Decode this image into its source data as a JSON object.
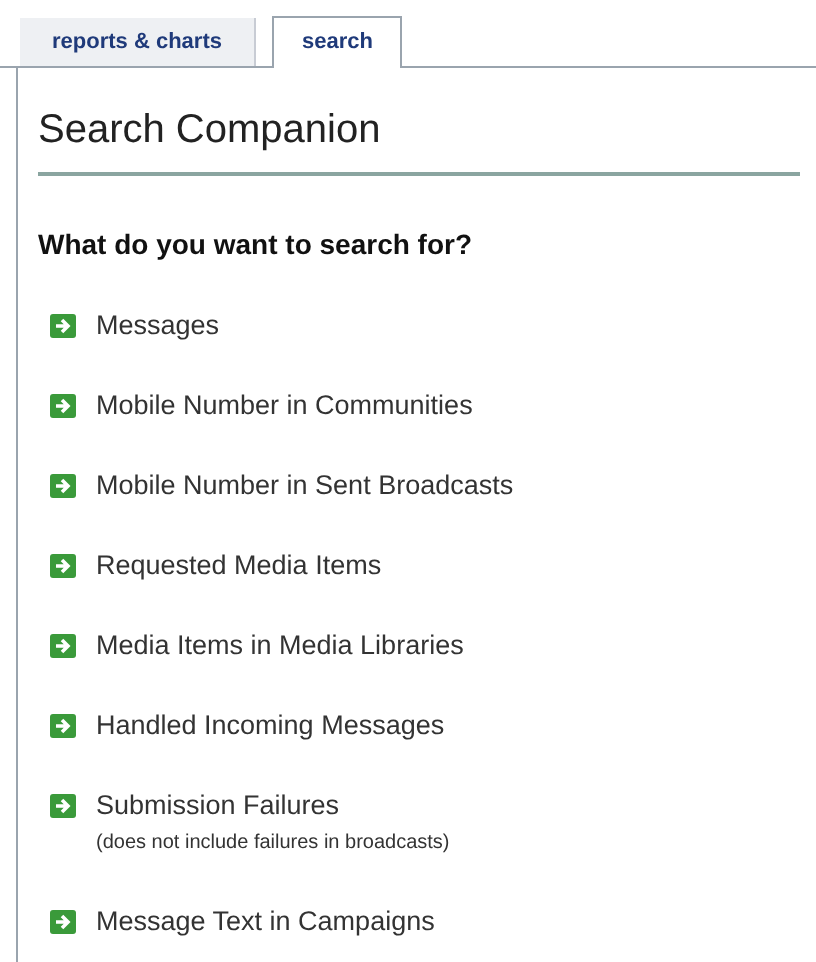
{
  "tabs": [
    {
      "label": "reports & charts",
      "selected": false
    },
    {
      "label": "search",
      "selected": true
    }
  ],
  "title": "Search Companion",
  "question": "What do you want to search for?",
  "items": [
    {
      "label": "Messages"
    },
    {
      "label": "Mobile Number in Communities"
    },
    {
      "label": "Mobile Number in Sent Broadcasts"
    },
    {
      "label": "Requested Media Items"
    },
    {
      "label": "Media Items in Media Libraries"
    },
    {
      "label": "Handled Incoming Messages"
    },
    {
      "label": "Submission Failures",
      "note": "(does not include failures in broadcasts)"
    },
    {
      "label": "Message Text in Campaigns"
    }
  ]
}
